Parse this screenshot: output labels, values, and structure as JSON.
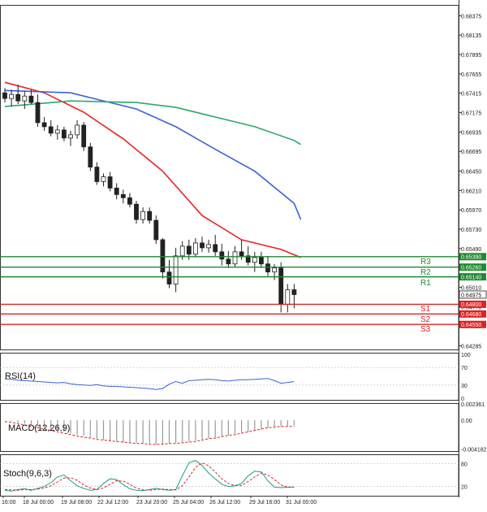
{
  "chart_data": [
    {
      "type": "candlestick",
      "title": "",
      "y_axis_ticks": [
        "0.68375",
        "0.68135",
        "0.67895",
        "0.67655",
        "0.67415",
        "0.67175",
        "0.66935",
        "0.66695",
        "0.66450",
        "0.66210",
        "0.65970",
        "0.65730",
        "0.65490",
        "0.65250",
        "0.65010",
        "0.64770",
        "0.64530",
        "0.64285"
      ],
      "ylim": [
        0.6424,
        0.6851
      ],
      "x_axis_ticks": [
        "16:00",
        "18 Jul 00:00",
        "19 Jul 08:00",
        "22 Jul 12:00",
        "23 Jul 20:00",
        "25 Jul 04:00",
        "26 Jul 12:00",
        "29 Jul 16:00",
        "31 Jul 00:00"
      ],
      "current_price": "0.64975",
      "ohlc": [
        [
          0.6742,
          0.6748,
          0.673,
          0.6735
        ],
        [
          0.6735,
          0.6746,
          0.6725,
          0.674
        ],
        [
          0.674,
          0.6752,
          0.6728,
          0.6732
        ],
        [
          0.6732,
          0.6744,
          0.6722,
          0.6738
        ],
        [
          0.6738,
          0.6746,
          0.6728,
          0.673
        ],
        [
          0.673,
          0.674,
          0.67,
          0.6705
        ],
        [
          0.6705,
          0.6712,
          0.6695,
          0.67
        ],
        [
          0.67,
          0.6708,
          0.6688,
          0.6692
        ],
        [
          0.6692,
          0.6702,
          0.6684,
          0.6696
        ],
        [
          0.6696,
          0.67,
          0.6682,
          0.6686
        ],
        [
          0.6686,
          0.6695,
          0.6676,
          0.669
        ],
        [
          0.669,
          0.6708,
          0.6685,
          0.6702
        ],
        [
          0.6702,
          0.6706,
          0.667,
          0.6675
        ],
        [
          0.6675,
          0.668,
          0.6645,
          0.665
        ],
        [
          0.665,
          0.6656,
          0.6628,
          0.6632
        ],
        [
          0.6632,
          0.6642,
          0.6626,
          0.6638
        ],
        [
          0.6638,
          0.6644,
          0.662,
          0.6624
        ],
        [
          0.6624,
          0.663,
          0.661,
          0.6616
        ],
        [
          0.6616,
          0.6622,
          0.6605,
          0.6612
        ],
        [
          0.6612,
          0.6618,
          0.66,
          0.6604
        ],
        [
          0.6604,
          0.6608,
          0.658,
          0.6585
        ],
        [
          0.6585,
          0.66,
          0.658,
          0.6595
        ],
        [
          0.6595,
          0.66,
          0.658,
          0.6584
        ],
        [
          0.6584,
          0.659,
          0.6555,
          0.656
        ],
        [
          0.656,
          0.6562,
          0.6512,
          0.652
        ],
        [
          0.652,
          0.6535,
          0.65,
          0.6505
        ],
        [
          0.6505,
          0.655,
          0.6495,
          0.654
        ],
        [
          0.654,
          0.6558,
          0.6535,
          0.6552
        ],
        [
          0.6552,
          0.656,
          0.6535,
          0.6542
        ],
        [
          0.6542,
          0.6562,
          0.6538,
          0.6556
        ],
        [
          0.6556,
          0.6564,
          0.6545,
          0.655
        ],
        [
          0.655,
          0.656,
          0.6544,
          0.6554
        ],
        [
          0.6554,
          0.6566,
          0.654,
          0.6545
        ],
        [
          0.6545,
          0.6555,
          0.6528,
          0.6536
        ],
        [
          0.6536,
          0.6546,
          0.6525,
          0.653
        ],
        [
          0.653,
          0.6552,
          0.6526,
          0.6545
        ],
        [
          0.6545,
          0.656,
          0.6535,
          0.654
        ],
        [
          0.654,
          0.6552,
          0.6528,
          0.6532
        ],
        [
          0.6532,
          0.6545,
          0.652,
          0.6538
        ],
        [
          0.6538,
          0.6545,
          0.6525,
          0.653
        ],
        [
          0.653,
          0.654,
          0.6515,
          0.652
        ],
        [
          0.652,
          0.653,
          0.651,
          0.6525
        ],
        [
          0.6525,
          0.6532,
          0.647,
          0.648
        ],
        [
          0.648,
          0.6505,
          0.647,
          0.6498
        ],
        [
          0.6498,
          0.6505,
          0.6475,
          0.6492
        ]
      ],
      "moving_averages": [
        {
          "color": "#ee2222",
          "points": [
            [
              0,
              0.6755
            ],
            [
              6,
              0.6742
            ],
            [
              12,
              0.6718
            ],
            [
              18,
              0.6685
            ],
            [
              24,
              0.6645
            ],
            [
              30,
              0.659
            ],
            [
              36,
              0.656
            ],
            [
              42,
              0.6548
            ],
            [
              45,
              0.6538
            ]
          ]
        },
        {
          "color": "#3b62d6",
          "points": [
            [
              0,
              0.6745
            ],
            [
              10,
              0.6742
            ],
            [
              20,
              0.6722
            ],
            [
              26,
              0.67
            ],
            [
              32,
              0.6672
            ],
            [
              38,
              0.6645
            ],
            [
              44,
              0.6605
            ],
            [
              45,
              0.6585
            ]
          ]
        },
        {
          "color": "#2aa86a",
          "points": [
            [
              0,
              0.6725
            ],
            [
              10,
              0.6732
            ],
            [
              20,
              0.673
            ],
            [
              26,
              0.6724
            ],
            [
              32,
              0.6712
            ],
            [
              38,
              0.67
            ],
            [
              44,
              0.6683
            ],
            [
              45,
              0.6678
            ]
          ]
        }
      ],
      "levels": [
        {
          "name": "R3",
          "value": 0.6539,
          "label": "0.65390",
          "color": "#1e8a2e"
        },
        {
          "name": "R2",
          "value": 0.6526,
          "label": "0.65260",
          "color": "#1e8a2e"
        },
        {
          "name": "R1",
          "value": 0.6514,
          "label": "0.65140",
          "color": "#1e8a2e"
        },
        {
          "name": "",
          "value": 0.648,
          "label": "0.64800",
          "color": "#dd2222"
        },
        {
          "name": "S1",
          "value": 0.6468,
          "label": "0.64680",
          "color": "#dd2222"
        },
        {
          "name": "S2",
          "value": 0.6455,
          "label": "0.64550",
          "color": "#dd2222"
        }
      ],
      "level_text": [
        {
          "name": "R3",
          "color": "#1e8a2e"
        },
        {
          "name": "R2",
          "color": "#1e8a2e"
        },
        {
          "name": "R1",
          "color": "#1e8a2e"
        },
        {
          "name": "S1",
          "color": "#dd2222"
        },
        {
          "name": "S2",
          "color": "#dd2222"
        },
        {
          "name": "S3",
          "color": "#dd2222"
        }
      ]
    },
    {
      "type": "line",
      "name": "RSI(14)",
      "y_axis_ticks": [
        "100",
        "70",
        "30",
        "0"
      ],
      "ylim": [
        0,
        100
      ],
      "values": [
        44,
        43,
        41,
        40,
        39,
        38,
        37,
        36,
        35,
        36,
        33,
        31,
        30,
        29,
        31,
        28,
        27,
        27,
        26,
        25,
        24,
        23,
        22,
        20,
        22,
        32,
        38,
        34,
        40,
        41,
        42,
        43,
        42,
        40,
        39,
        41,
        42,
        42,
        43,
        44,
        45,
        40,
        34,
        36,
        38
      ]
    },
    {
      "type": "bar",
      "name": "MACD(12,26,9)",
      "y_axis_ticks": [
        "0.002361",
        "0.00",
        "-0.004182"
      ],
      "ylim": [
        -0.0045,
        0.0025
      ],
      "histogram": [
        0.0,
        -0.0001,
        -0.0003,
        -0.0005,
        -0.0007,
        -0.0009,
        -0.0011,
        -0.0013,
        -0.0015,
        -0.0017,
        -0.0019,
        -0.0021,
        -0.0023,
        -0.0025,
        -0.0027,
        -0.0029,
        -0.003,
        -0.0031,
        -0.0032,
        -0.0033,
        -0.0033,
        -0.0034,
        -0.0034,
        -0.0035,
        -0.0035,
        -0.0034,
        -0.0033,
        -0.0032,
        -0.0031,
        -0.003,
        -0.0028,
        -0.0027,
        -0.0025,
        -0.0023,
        -0.0022,
        -0.002,
        -0.0018,
        -0.0017,
        -0.0015,
        -0.0013,
        -0.0011,
        -0.0009,
        -0.0009,
        -0.0009,
        -0.0008
      ],
      "signal": [
        -0.0002,
        -0.0003,
        -0.0005,
        -0.0007,
        -0.0009,
        -0.0011,
        -0.0013,
        -0.0015,
        -0.0017,
        -0.0019,
        -0.0021,
        -0.0023,
        -0.0025,
        -0.0026,
        -0.0028,
        -0.0029,
        -0.003,
        -0.0031,
        -0.0032,
        -0.0033,
        -0.0034,
        -0.0034,
        -0.0035,
        -0.0035,
        -0.0035,
        -0.0034,
        -0.0034,
        -0.0033,
        -0.0032,
        -0.0031,
        -0.0029,
        -0.0027,
        -0.0026,
        -0.0024,
        -0.0022,
        -0.0021,
        -0.0019,
        -0.0017,
        -0.0015,
        -0.0013,
        -0.0011,
        -0.001,
        -0.0009,
        -0.0009,
        -0.0009
      ]
    },
    {
      "type": "line",
      "name": "Stoch(9,6,3)",
      "y_axis_ticks": [
        "80",
        "20"
      ],
      "ylim": [
        0,
        100
      ],
      "k": [
        10,
        8,
        12,
        14,
        10,
        15,
        20,
        30,
        45,
        50,
        35,
        22,
        15,
        10,
        12,
        28,
        40,
        38,
        25,
        14,
        10,
        9,
        12,
        15,
        12,
        10,
        12,
        48,
        82,
        88,
        75,
        55,
        40,
        26,
        20,
        22,
        28,
        48,
        60,
        58,
        35,
        18,
        17,
        18,
        19
      ],
      "d": [
        12,
        11,
        10,
        12,
        12,
        13,
        16,
        22,
        32,
        42,
        43,
        36,
        24,
        16,
        12,
        16,
        26,
        35,
        34,
        26,
        16,
        11,
        10,
        12,
        13,
        12,
        11,
        22,
        45,
        70,
        82,
        74,
        58,
        40,
        28,
        22,
        23,
        33,
        45,
        55,
        50,
        38,
        24,
        18,
        18
      ]
    }
  ]
}
